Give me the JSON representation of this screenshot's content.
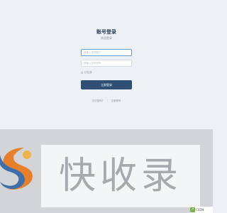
{
  "login": {
    "title": "账号登录",
    "subtitle": "欢迎登录",
    "account_placeholder": "请输入您的账户",
    "password_placeholder": "请输入您的密码",
    "remember_label": "记住我",
    "login_button": "立即登录",
    "forgot_link": "忘记密码？",
    "register_link": "注册账号",
    "separator": "|"
  },
  "banner": {
    "logo_text": "快收录",
    "colors": {
      "orange": "#e8802b",
      "blue": "#3f6fa8",
      "grey": "#a7a9ae"
    }
  },
  "badge": {
    "icon": "share-icon",
    "text": "CSDN"
  },
  "colors": {
    "background": "#edf1f5",
    "primary_button": "#2f4f74",
    "title": "#2b3e5c"
  }
}
